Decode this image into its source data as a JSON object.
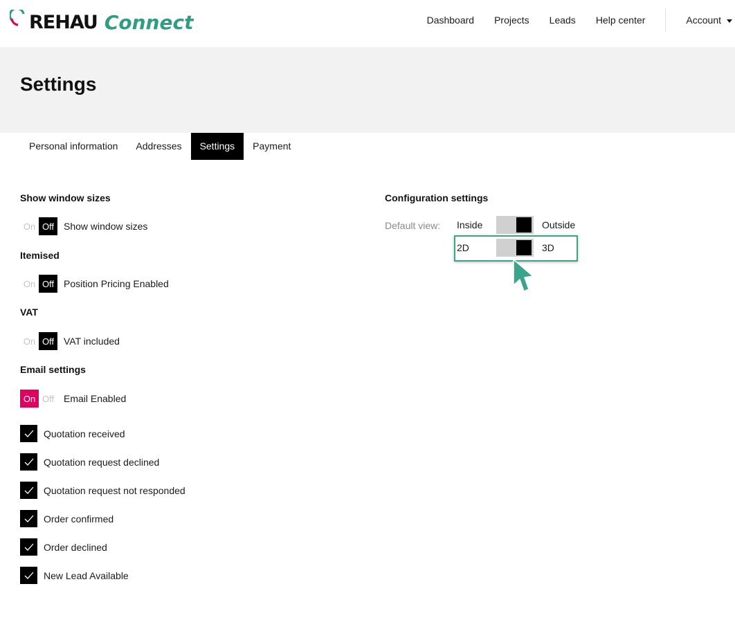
{
  "header": {
    "logo_primary": "REHAU",
    "logo_secondary": "Connect",
    "nav": [
      "Dashboard",
      "Projects",
      "Leads",
      "Help center"
    ],
    "account_label": "Account"
  },
  "page_title": "Settings",
  "tabs": [
    {
      "label": "Personal information",
      "active": false
    },
    {
      "label": "Addresses",
      "active": false
    },
    {
      "label": "Settings",
      "active": true
    },
    {
      "label": "Payment",
      "active": false
    }
  ],
  "toggle_on": "On",
  "toggle_off": "Off",
  "sections": {
    "window_sizes": {
      "title": "Show window sizes",
      "label": "Show window sizes",
      "state": "Off"
    },
    "itemised": {
      "title": "Itemised",
      "label": "Position Pricing Enabled",
      "state": "Off"
    },
    "vat": {
      "title": "VAT",
      "label": "VAT included",
      "state": "Off"
    },
    "email": {
      "title": "Email settings",
      "label": "Email Enabled",
      "state": "On"
    }
  },
  "email_checks": [
    {
      "label": "Quotation received",
      "checked": true
    },
    {
      "label": "Quotation request declined",
      "checked": true
    },
    {
      "label": "Quotation request not responded",
      "checked": true
    },
    {
      "label": "Order confirmed",
      "checked": true
    },
    {
      "label": "Order declined",
      "checked": true
    },
    {
      "label": "New Lead Available",
      "checked": true
    }
  ],
  "configuration": {
    "title": "Configuration settings",
    "default_view_label": "Default view:",
    "rows": [
      {
        "left": "Inside",
        "right": "Outside",
        "selected": "Outside"
      },
      {
        "left": "2D",
        "right": "3D",
        "selected": "3D"
      }
    ]
  },
  "colors": {
    "brand_green": "#2e9e82",
    "brand_pink": "#e0005e",
    "highlight": "#3aa58b",
    "banner_bg": "#f2f2f2"
  }
}
